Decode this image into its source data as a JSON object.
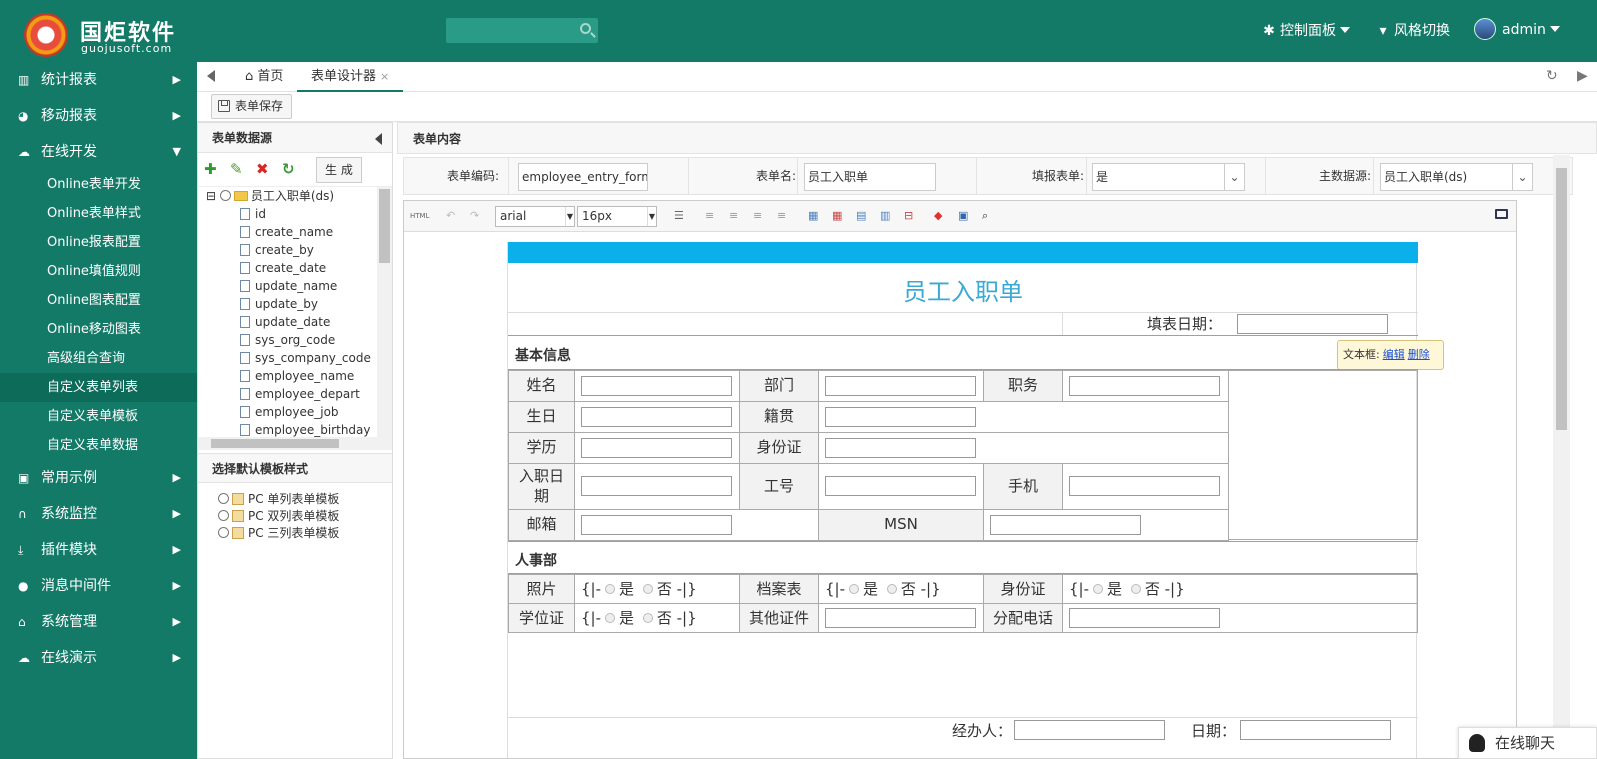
{
  "header": {
    "logo_title": "国炬软件",
    "logo_sub": "guojusoft.com",
    "nav_control": "控制面板",
    "nav_style": "风格切换",
    "user": "admin"
  },
  "sidebar": {
    "items": [
      {
        "label": "统计报表",
        "icon": "bar-chart-icon"
      },
      {
        "label": "移动报表",
        "icon": "pie-chart-icon"
      },
      {
        "label": "在线开发",
        "icon": "cloud-icon"
      }
    ],
    "sub_items": [
      {
        "label": "Online表单开发"
      },
      {
        "label": "Online表单样式"
      },
      {
        "label": "Online报表配置"
      },
      {
        "label": "Online填值规则"
      },
      {
        "label": "Online图表配置"
      },
      {
        "label": "Online移动图表"
      },
      {
        "label": "高级组合查询"
      },
      {
        "label": "自定义表单列表"
      },
      {
        "label": "自定义表单模板"
      },
      {
        "label": "自定义表单数据"
      }
    ],
    "items2": [
      {
        "label": "常用示例",
        "icon": "twitch-icon"
      },
      {
        "label": "系统监控",
        "icon": "headphones-icon"
      },
      {
        "label": "插件模块",
        "icon": "download-icon"
      },
      {
        "label": "消息中间件",
        "icon": "comment-icon"
      },
      {
        "label": "系统管理",
        "icon": "home-icon"
      },
      {
        "label": "在线演示",
        "icon": "cloud-icon"
      }
    ]
  },
  "tabs": {
    "home": "首页",
    "designer": "表单设计器",
    "close": "×"
  },
  "toolbar": {
    "save_label": "表单保存"
  },
  "left_panel": {
    "title": "表单数据源",
    "generate_label": "生 成",
    "root": "员工入职单(ds)",
    "fields": [
      "id",
      "create_name",
      "create_by",
      "create_date",
      "update_name",
      "update_by",
      "update_date",
      "sys_org_code",
      "sys_company_code",
      "employee_name",
      "employee_depart",
      "employee_job",
      "employee_birthday"
    ],
    "template_title": "选择默认模板样式",
    "templates": [
      "PC 单列表单模板",
      "PC 双列表单模板",
      "PC 三列表单模板"
    ]
  },
  "right_panel": {
    "title": "表单内容",
    "code_label": "表单编码:",
    "code_value": "employee_entry_form",
    "name_label": "表单名:",
    "name_value": "员工入职单",
    "fill_label": "填报表单:",
    "fill_value": "是",
    "ds_label": "主数据源:",
    "ds_value": "员工入职单(ds)"
  },
  "editor_toolbar": {
    "html": "HTML",
    "font": "arial",
    "size": "16px"
  },
  "form": {
    "title": "员工入职单",
    "fill_date_label": "填表日期：",
    "tooltip_label": "文本框:",
    "tooltip_edit": "编辑",
    "tooltip_delete": "删除",
    "section_basic": "基本信息",
    "section_hr": "人事部",
    "name": "姓名",
    "dept": "部门",
    "duty": "职务",
    "birthday": "生日",
    "origin": "籍贯",
    "edu": "学历",
    "idcard": "身份证",
    "entry_date_1": "入职日",
    "entry_date_2": "期",
    "job_no": "工号",
    "mobile": "手机",
    "email": "邮箱",
    "msn": "MSN",
    "photo": "照片",
    "archive": "档案表",
    "idcard2": "身份证",
    "degree": "学位证",
    "other_cert": "其他证件",
    "phone": "分配电话",
    "opt_prefix": "{|-",
    "opt_yes": "是",
    "opt_no": "否",
    "opt_suffix": "-|}",
    "handler": "经办人：",
    "date": "日期："
  },
  "chat": {
    "label": "在线聊天"
  }
}
